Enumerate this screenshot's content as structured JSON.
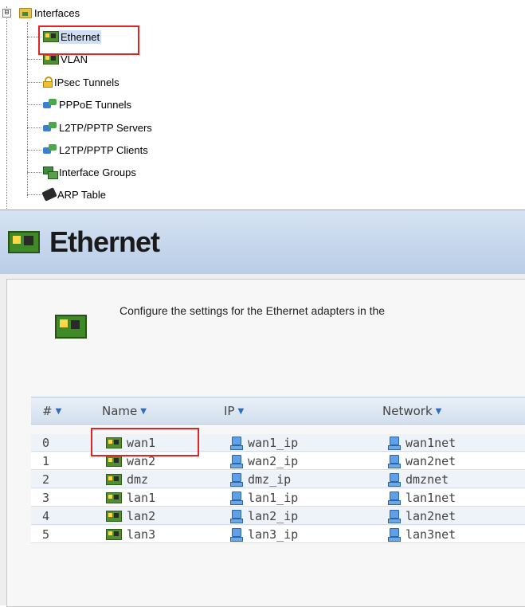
{
  "tree": {
    "root": {
      "label": "Interfaces",
      "expander": "⊟",
      "icon": "folder-icon"
    },
    "items": [
      {
        "label": "Ethernet",
        "icon": "nic-icon",
        "selected": true
      },
      {
        "label": "VLAN",
        "icon": "vlan-icon"
      },
      {
        "label": "IPsec Tunnels",
        "icon": "lock-icon"
      },
      {
        "label": "PPPoE Tunnels",
        "icon": "tunnel-icon"
      },
      {
        "label": "L2TP/PPTP Servers",
        "icon": "tunnel-icon"
      },
      {
        "label": "L2TP/PPTP Clients",
        "icon": "tunnel-icon"
      },
      {
        "label": "Interface Groups",
        "icon": "group-icon"
      },
      {
        "label": "ARP Table",
        "icon": "arp-icon"
      }
    ]
  },
  "header": {
    "title": "Ethernet",
    "icon": "nic-icon"
  },
  "description": "Configure the settings for the Ethernet adapters in the",
  "table": {
    "columns": [
      {
        "label": "#",
        "caret": "▼"
      },
      {
        "label": "Name",
        "caret": "▼"
      },
      {
        "label": "IP",
        "caret": "▼"
      },
      {
        "label": "Network",
        "caret": "▼"
      }
    ],
    "rows": [
      {
        "index": "0",
        "name": "wan1",
        "ip": "wan1_ip",
        "network": "wan1net"
      },
      {
        "index": "1",
        "name": "wan2",
        "ip": "wan2_ip",
        "network": "wan2net"
      },
      {
        "index": "2",
        "name": "dmz",
        "ip": "dmz_ip",
        "network": "dmznet"
      },
      {
        "index": "3",
        "name": "lan1",
        "ip": "lan1_ip",
        "network": "lan1net"
      },
      {
        "index": "4",
        "name": "lan2",
        "ip": "lan2_ip",
        "network": "lan2net"
      },
      {
        "index": "5",
        "name": "lan3",
        "ip": "lan3_ip",
        "network": "lan3net"
      }
    ]
  },
  "colors": {
    "highlight": "#e02424",
    "header_bg": "#c6d7ec",
    "selected_bg": "#cfe0f6"
  }
}
